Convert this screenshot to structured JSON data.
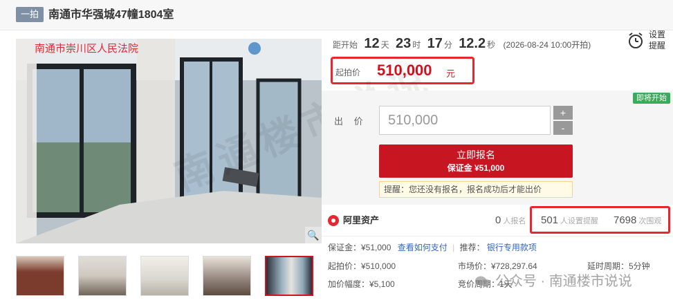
{
  "header": {
    "tag": "一拍",
    "title": "南通市华强城47幢1804室"
  },
  "photo": {
    "court_label": "南通市崇川区人民法院",
    "zoom_icon": "search-icon"
  },
  "countdown": {
    "prefix": "距开始",
    "days": "12",
    "days_unit": "天",
    "hours": "23",
    "hours_unit": "时",
    "minutes": "17",
    "minutes_unit": "分",
    "seconds": "12.2",
    "seconds_unit": "秒",
    "start_time": "(2026-08-24 10:00开拍)"
  },
  "reminder": {
    "label": "设置提醒"
  },
  "start_price": {
    "label": "起拍价",
    "value": "510,000",
    "unit": "元"
  },
  "bid": {
    "status_badge": "即将开始",
    "label": "出 价",
    "input_value": "510,000",
    "plus": "+",
    "minus": "-",
    "register_label": "立即报名",
    "deposit_label": "保证金 ¥51,000",
    "tip": "提醒：您还没有报名，报名成功后才能出价"
  },
  "stats": {
    "brand": "阿里资产",
    "signups_value": "0",
    "signups_label": "人报名",
    "reminders_value": "501",
    "reminders_label": "人设置提醒",
    "views_value": "7698",
    "views_label": "次围观"
  },
  "info": {
    "deposit": "保证金：¥51,000",
    "how_to_pay": "查看如何支付",
    "recommend_label": "推荐：",
    "recommend_link": "银行专用款项",
    "start_price": "起拍价：¥510,000",
    "market_price": "市场价：¥728,297.64",
    "extension": "延时周期：5分钟",
    "increment": "加价幅度：¥5,100",
    "auction_period": "竞价周期：1天"
  },
  "watermarks": {
    "center": "南通楼市说说",
    "footer": "公众号 · 南通楼市说说"
  }
}
